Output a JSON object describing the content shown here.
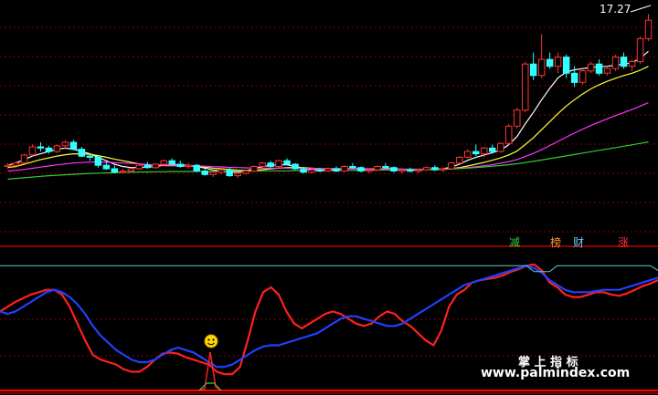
{
  "price_label": "17.27",
  "markers": [
    {
      "text": "减",
      "color": "#33cc33"
    },
    {
      "text": "榜",
      "color": "#ff9933"
    },
    {
      "text": "财",
      "color": "#66ccff"
    },
    {
      "text": "涨",
      "color": "#ff3333"
    }
  ],
  "watermark": {
    "line1": "掌 上 指 标",
    "line2": "www.palmindex.com"
  },
  "colors": {
    "background": "#000000",
    "grid": "#8b0000",
    "candle_up": "#ff3333",
    "candle_down": "#33ffff",
    "ma_white": "#ffffff",
    "ma_yellow": "#ffff33",
    "ma_magenta": "#ff33ff",
    "ma_green": "#33cc33",
    "osc_red": "#ff2020",
    "osc_blue": "#2040ff",
    "osc_cyan": "#66cccc"
  },
  "chart_data": [
    {
      "type": "candlestick",
      "title": "",
      "ylim": [
        7.5,
        17.8
      ],
      "last_high": 17.27,
      "ohlc": [
        [
          10.65,
          10.8,
          10.55,
          10.7
        ],
        [
          10.7,
          10.85,
          10.6,
          10.8
        ],
        [
          10.8,
          11.2,
          10.75,
          11.15
        ],
        [
          11.15,
          11.6,
          11.1,
          11.5
        ],
        [
          11.5,
          11.7,
          11.3,
          11.45
        ],
        [
          11.45,
          11.55,
          11.2,
          11.3
        ],
        [
          11.3,
          11.6,
          11.25,
          11.55
        ],
        [
          11.55,
          11.8,
          11.4,
          11.7
        ],
        [
          11.7,
          11.8,
          11.35,
          11.4
        ],
        [
          11.4,
          11.5,
          11.05,
          11.1
        ],
        [
          11.1,
          11.2,
          10.9,
          11.05
        ],
        [
          11.05,
          11.1,
          10.6,
          10.7
        ],
        [
          10.7,
          10.85,
          10.5,
          10.55
        ],
        [
          10.55,
          10.7,
          10.35,
          10.4
        ],
        [
          10.4,
          10.55,
          10.35,
          10.45
        ],
        [
          10.45,
          10.6,
          10.4,
          10.55
        ],
        [
          10.55,
          10.75,
          10.5,
          10.7
        ],
        [
          10.7,
          10.85,
          10.55,
          10.6
        ],
        [
          10.6,
          10.8,
          10.55,
          10.75
        ],
        [
          10.75,
          10.95,
          10.7,
          10.9
        ],
        [
          10.9,
          11.0,
          10.7,
          10.75
        ],
        [
          10.75,
          10.9,
          10.6,
          10.65
        ],
        [
          10.65,
          10.8,
          10.55,
          10.7
        ],
        [
          10.7,
          10.75,
          10.4,
          10.45
        ],
        [
          10.45,
          10.55,
          10.25,
          10.3
        ],
        [
          10.3,
          10.45,
          10.2,
          10.4
        ],
        [
          10.4,
          10.55,
          10.3,
          10.5
        ],
        [
          10.5,
          10.6,
          10.2,
          10.25
        ],
        [
          10.25,
          10.4,
          10.15,
          10.35
        ],
        [
          10.35,
          10.5,
          10.3,
          10.45
        ],
        [
          10.45,
          10.7,
          10.4,
          10.65
        ],
        [
          10.65,
          10.85,
          10.6,
          10.8
        ],
        [
          10.8,
          10.9,
          10.6,
          10.65
        ],
        [
          10.65,
          10.95,
          10.6,
          10.9
        ],
        [
          10.9,
          11.0,
          10.7,
          10.75
        ],
        [
          10.75,
          10.8,
          10.5,
          10.55
        ],
        [
          10.55,
          10.6,
          10.35,
          10.4
        ],
        [
          10.4,
          10.55,
          10.35,
          10.5
        ],
        [
          10.5,
          10.6,
          10.4,
          10.45
        ],
        [
          10.45,
          10.6,
          10.4,
          10.55
        ],
        [
          10.55,
          10.65,
          10.4,
          10.45
        ],
        [
          10.45,
          10.7,
          10.4,
          10.65
        ],
        [
          10.65,
          10.8,
          10.55,
          10.6
        ],
        [
          10.6,
          10.65,
          10.4,
          10.45
        ],
        [
          10.45,
          10.55,
          10.35,
          10.5
        ],
        [
          10.5,
          10.7,
          10.45,
          10.65
        ],
        [
          10.65,
          10.8,
          10.55,
          10.6
        ],
        [
          10.6,
          10.65,
          10.4,
          10.45
        ],
        [
          10.45,
          10.55,
          10.35,
          10.5
        ],
        [
          10.5,
          10.6,
          10.4,
          10.45
        ],
        [
          10.45,
          10.55,
          10.35,
          10.5
        ],
        [
          10.5,
          10.65,
          10.45,
          10.6
        ],
        [
          10.6,
          10.7,
          10.45,
          10.5
        ],
        [
          10.5,
          10.6,
          10.4,
          10.55
        ],
        [
          10.55,
          10.85,
          10.5,
          10.8
        ],
        [
          10.8,
          11.1,
          10.75,
          11.05
        ],
        [
          11.05,
          11.4,
          11.0,
          11.3
        ],
        [
          11.3,
          11.6,
          11.1,
          11.2
        ],
        [
          11.2,
          11.5,
          11.05,
          11.45
        ],
        [
          11.45,
          11.6,
          11.2,
          11.3
        ],
        [
          11.3,
          11.7,
          11.25,
          11.65
        ],
        [
          11.65,
          12.5,
          11.6,
          12.4
        ],
        [
          12.4,
          13.2,
          12.3,
          13.1
        ],
        [
          13.1,
          15.2,
          13.0,
          15.1
        ],
        [
          15.1,
          15.6,
          14.4,
          14.6
        ],
        [
          14.6,
          16.4,
          14.5,
          15.3
        ],
        [
          15.3,
          15.6,
          14.9,
          15.0
        ],
        [
          15.0,
          15.6,
          14.7,
          15.4
        ],
        [
          15.4,
          15.5,
          14.5,
          14.7
        ],
        [
          14.7,
          15.0,
          14.1,
          14.3
        ],
        [
          14.3,
          14.9,
          14.2,
          14.8
        ],
        [
          14.8,
          15.2,
          14.7,
          15.1
        ],
        [
          15.1,
          15.3,
          14.6,
          14.7
        ],
        [
          14.7,
          15.0,
          14.6,
          14.9
        ],
        [
          14.9,
          15.5,
          14.8,
          15.4
        ],
        [
          15.4,
          15.6,
          14.9,
          15.0
        ],
        [
          15.0,
          15.3,
          14.8,
          15.2
        ],
        [
          15.2,
          16.3,
          15.1,
          16.2
        ],
        [
          16.2,
          17.27,
          16.1,
          17.0
        ]
      ],
      "ma": [
        {
          "values": [
            10.7,
            10.8,
            10.95,
            11.1,
            11.2,
            11.3,
            11.4,
            11.45,
            11.4,
            11.3,
            11.2,
            11.05,
            10.9,
            10.75,
            10.65,
            10.6,
            10.6,
            10.62,
            10.65,
            10.7,
            10.72,
            10.72,
            10.7,
            10.65,
            10.58,
            10.5,
            10.45,
            10.42,
            10.4,
            10.45,
            10.55,
            10.65,
            10.7,
            10.72,
            10.72,
            10.65,
            10.58,
            10.52,
            10.5,
            10.5,
            10.52,
            10.55,
            10.56,
            10.55,
            10.52,
            10.54,
            10.56,
            10.55,
            10.52,
            10.5,
            10.5,
            10.52,
            10.53,
            10.55,
            10.62,
            10.75,
            10.92,
            11.05,
            11.15,
            11.25,
            11.35,
            11.6,
            11.95,
            12.5,
            13.0,
            13.55,
            14.05,
            14.5,
            14.75,
            14.85,
            14.9,
            14.95,
            14.98,
            15.0,
            15.05,
            15.1,
            15.15,
            15.35,
            15.65
          ]
        },
        {
          "values": [
            10.6,
            10.65,
            10.75,
            10.85,
            10.95,
            11.02,
            11.1,
            11.16,
            11.2,
            11.2,
            11.18,
            11.12,
            11.05,
            10.97,
            10.9,
            10.83,
            10.76,
            10.72,
            10.7,
            10.69,
            10.68,
            10.68,
            10.67,
            10.65,
            10.62,
            10.58,
            10.55,
            10.52,
            10.49,
            10.47,
            10.48,
            10.51,
            10.55,
            10.58,
            10.6,
            10.61,
            10.6,
            10.58,
            10.56,
            10.55,
            10.55,
            10.55,
            10.55,
            10.55,
            10.54,
            10.54,
            10.54,
            10.54,
            10.53,
            10.52,
            10.52,
            10.52,
            10.52,
            10.53,
            10.56,
            10.6,
            10.67,
            10.75,
            10.83,
            10.92,
            11.02,
            11.15,
            11.32,
            11.6,
            11.9,
            12.25,
            12.6,
            12.95,
            13.27,
            13.55,
            13.8,
            14.02,
            14.2,
            14.35,
            14.48,
            14.6,
            14.7,
            14.83,
            15.0
          ]
        },
        {
          "values": [
            10.45,
            10.48,
            10.52,
            10.57,
            10.62,
            10.67,
            10.72,
            10.76,
            10.8,
            10.82,
            10.84,
            10.84,
            10.83,
            10.82,
            10.8,
            10.78,
            10.76,
            10.74,
            10.72,
            10.71,
            10.7,
            10.69,
            10.68,
            10.67,
            10.66,
            10.64,
            10.63,
            10.61,
            10.6,
            10.59,
            10.58,
            10.58,
            10.58,
            10.58,
            10.58,
            10.58,
            10.57,
            10.57,
            10.56,
            10.56,
            10.55,
            10.55,
            10.55,
            10.55,
            10.55,
            10.55,
            10.54,
            10.54,
            10.54,
            10.54,
            10.53,
            10.53,
            10.53,
            10.54,
            10.55,
            10.57,
            10.6,
            10.64,
            10.68,
            10.73,
            10.79,
            10.86,
            10.95,
            11.08,
            11.22,
            11.38,
            11.56,
            11.74,
            11.92,
            12.1,
            12.27,
            12.43,
            12.58,
            12.72,
            12.86,
            12.99,
            13.12,
            13.27,
            13.42
          ]
        },
        {
          "values": [
            10.1,
            10.13,
            10.16,
            10.19,
            10.22,
            10.25,
            10.27,
            10.29,
            10.31,
            10.33,
            10.35,
            10.36,
            10.37,
            10.38,
            10.39,
            10.4,
            10.41,
            10.41,
            10.42,
            10.42,
            10.43,
            10.43,
            10.43,
            10.44,
            10.44,
            10.44,
            10.44,
            10.45,
            10.45,
            10.45,
            10.45,
            10.46,
            10.46,
            10.46,
            10.46,
            10.47,
            10.47,
            10.47,
            10.47,
            10.48,
            10.48,
            10.48,
            10.48,
            10.49,
            10.49,
            10.49,
            10.5,
            10.5,
            10.5,
            10.51,
            10.51,
            10.52,
            10.52,
            10.53,
            10.54,
            10.56,
            10.58,
            10.6,
            10.63,
            10.66,
            10.69,
            10.73,
            10.77,
            10.82,
            10.87,
            10.93,
            10.99,
            11.05,
            11.11,
            11.17,
            11.23,
            11.29,
            11.35,
            11.41,
            11.47,
            11.53,
            11.59,
            11.65,
            11.72
          ]
        }
      ]
    },
    {
      "type": "line",
      "title": "",
      "ylim": [
        -5,
        110
      ],
      "series": [
        {
          "values": [
            62,
            66,
            70,
            73,
            76,
            78,
            80,
            80,
            76,
            66,
            52,
            38,
            26,
            22,
            20,
            18,
            14,
            12,
            12,
            16,
            22,
            27,
            28,
            27,
            24,
            22,
            20,
            18,
            12,
            10,
            10,
            16,
            38,
            62,
            78,
            82,
            76,
            62,
            52,
            48,
            52,
            56,
            60,
            62,
            60,
            56,
            52,
            50,
            52,
            58,
            62,
            60,
            54,
            50,
            44,
            38,
            34,
            46,
            66,
            76,
            80,
            86,
            88,
            89,
            90,
            92,
            95,
            97,
            100,
            101,
            96,
            86,
            82,
            76,
            74,
            74,
            76,
            78,
            78,
            76,
            75,
            77,
            80,
            83,
            85,
            88
          ]
        },
        {
          "values": [
            62,
            60,
            62,
            66,
            70,
            74,
            78,
            80,
            78,
            74,
            68,
            60,
            50,
            42,
            36,
            30,
            26,
            22,
            20,
            20,
            22,
            26,
            30,
            32,
            30,
            28,
            24,
            20,
            16,
            16,
            18,
            22,
            26,
            30,
            33,
            34,
            34,
            36,
            38,
            40,
            42,
            44,
            48,
            52,
            56,
            58,
            58,
            56,
            54,
            52,
            50,
            50,
            52,
            56,
            60,
            64,
            68,
            72,
            76,
            80,
            84,
            86,
            88,
            90,
            92,
            94,
            96,
            98,
            100,
            98,
            94,
            88,
            84,
            80,
            78,
            78,
            78,
            79,
            80,
            80,
            80,
            82,
            84,
            86,
            88,
            90
          ]
        },
        {
          "values": [
            100,
            100,
            100,
            100,
            100,
            100,
            100,
            100,
            100,
            100,
            100,
            100,
            100,
            100,
            100,
            100,
            100,
            100,
            100,
            100,
            100,
            100,
            100,
            100,
            100,
            100,
            100,
            100,
            100,
            100,
            100,
            100,
            100,
            100,
            100,
            100,
            100,
            100,
            100,
            100,
            100,
            100,
            100,
            100,
            100,
            100,
            100,
            100,
            100,
            100,
            100,
            100,
            100,
            100,
            100,
            100,
            100,
            100,
            100,
            100,
            100,
            100,
            100,
            100,
            100,
            100,
            100,
            100,
            100,
            95,
            95,
            95,
            100,
            100,
            100,
            100,
            100,
            100,
            100,
            100,
            100,
            100,
            100,
            100,
            100,
            96
          ]
        }
      ]
    }
  ]
}
